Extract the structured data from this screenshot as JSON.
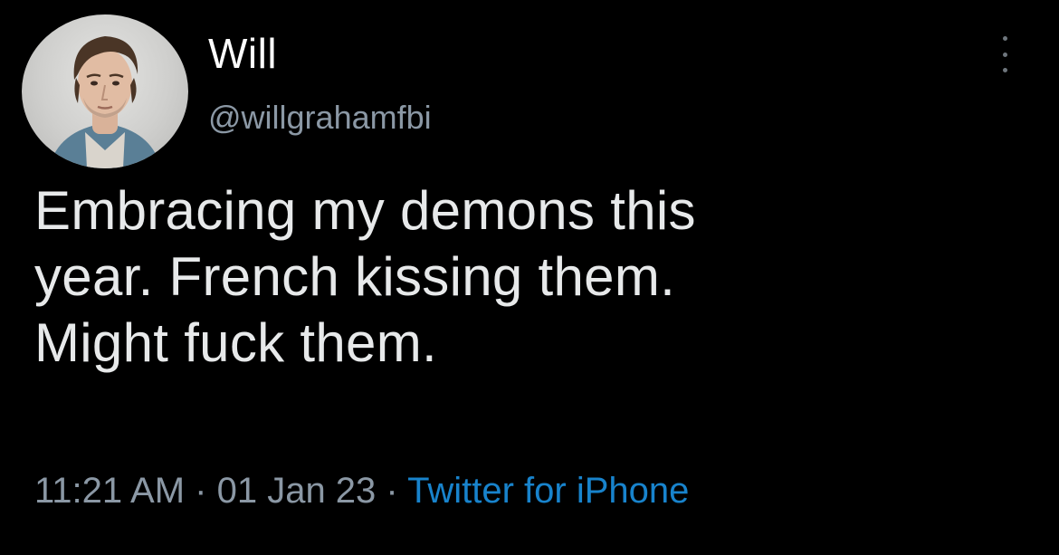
{
  "tweet": {
    "author": {
      "display_name": "Will",
      "handle": "@willgrahamfbi",
      "avatar": "profile-photo"
    },
    "more_icon": "more-vertical-icon",
    "text_lines": [
      "Embracing my demons this",
      "year. French kissing them.",
      "Might fuck them."
    ],
    "meta": {
      "time": "11:21 AM",
      "separator": " · ",
      "date": "01 Jan 23",
      "source": "Twitter for iPhone"
    }
  },
  "colors": {
    "background": "#000000",
    "text": "#e7e9ea",
    "secondary": "#8b98a5",
    "accent": "#1d9bf0"
  }
}
